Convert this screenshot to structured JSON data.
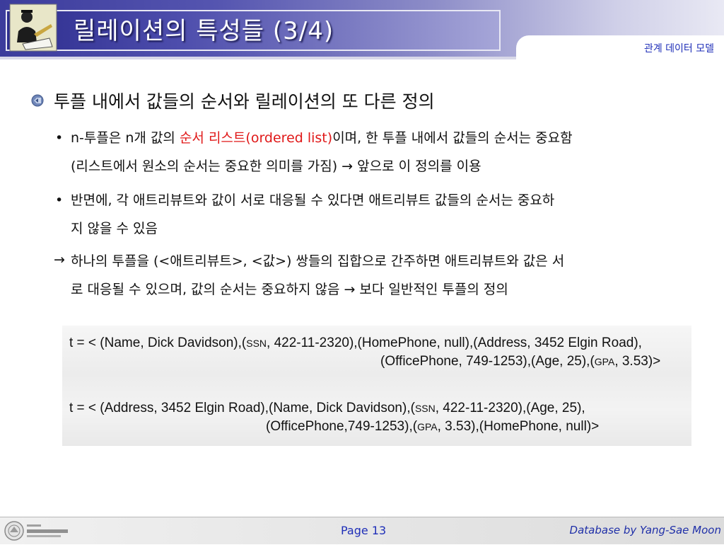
{
  "header": {
    "title": "릴레이션의 특성들 (3/4)",
    "section_tab": "관계 데이터 모델"
  },
  "content": {
    "heading": "투플 내에서 값들의 순서와 릴레이션의 또 다른 정의",
    "bullet1_pre": "n-투플은 n개 값의 ",
    "bullet1_red": "순서 리스트",
    "bullet1_paren": "(ordered list)",
    "bullet1_post": "이며, 한 투플 내에서 값들의 순서는 중요함",
    "bullet1_line2": "(리스트에서 원소의 순서는 중요한 의미를 가짐) → 앞으로 이 정의를 이용",
    "bullet2_line1": "반면에, 각 애트리뷰트와 값이 서로 대응될 수 있다면 애트리뷰트 값들의 순서는 중요하",
    "bullet2_line2": "지 않을 수 있음",
    "arrow_line1": "하나의 투플을 (<애트리뷰트>, <값>) 쌍들의 집합으로 간주하면 애트리뷰트와 값은 서",
    "arrow_line2": "로 대응될 수 있으며, 값의 순서는 중요하지 않음 → 보다 일반적인 투플의 정의",
    "bullet_symbol": "•",
    "arrow_symbol": "→"
  },
  "formulas": {
    "f1_line1_a": "t = < (Name, Dick Davidson),(",
    "f1_line1_ssn": "SSN",
    "f1_line1_b": ", 422-11-2320),(HomePhone, null),(Address, 3452 Elgin Road),",
    "f1_line2_a": "(OfficePhone, 749-1253),(Age, 25),(",
    "f1_line2_gpa": "GPA",
    "f1_line2_b": ", 3.53)>",
    "f2_line1_a": "t = < (Address, 3452 Elgin Road),(Name, Dick Davidson),(",
    "f2_line1_ssn": "SSN",
    "f2_line1_b": ", 422-11-2320),(Age, 25),",
    "f2_line2_a": "(OfficePhone,749-1253),(",
    "f2_line2_gpa": "GPA",
    "f2_line2_b": ", 3.53),(HomePhone, null)>"
  },
  "footer": {
    "page": "Page 13",
    "credit": "Database by Yang-Sae Moon",
    "logo_text": "강원대학교 컴퓨터과학과"
  },
  "colors": {
    "title_blue": "#2d2d8e",
    "accent_red": "#e01818",
    "link_blue": "#1f2fb8"
  }
}
